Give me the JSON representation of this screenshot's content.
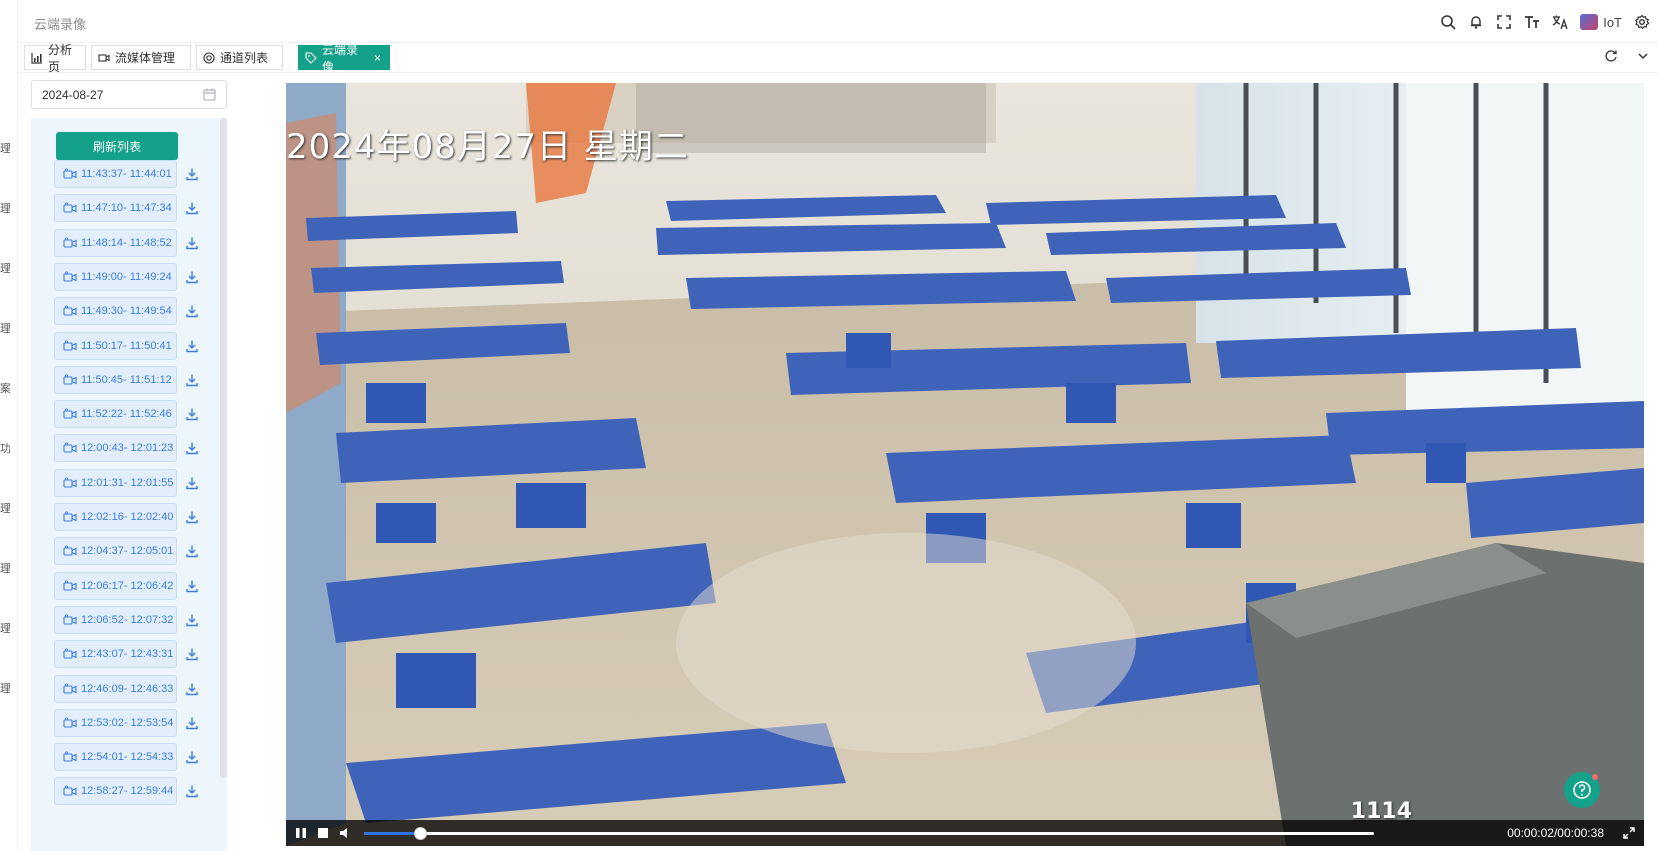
{
  "header": {
    "breadcrumb": "云端录像",
    "brand": "IoT",
    "icons": [
      "search-icon",
      "bell-icon",
      "fullscreen-icon",
      "font-size-icon",
      "translate-icon",
      "settings-icon"
    ]
  },
  "tabs": [
    {
      "label": "分析页",
      "icon": "chart-icon",
      "active": false
    },
    {
      "label": "流媒体管理",
      "icon": "video-icon",
      "active": false
    },
    {
      "label": "通道列表",
      "icon": "target-icon",
      "active": false
    },
    {
      "label": "云端录像",
      "icon": "tag-icon",
      "active": true
    }
  ],
  "sidebar_glyphs": [
    "理",
    "理",
    "理",
    "理",
    "案",
    "功",
    "理",
    "理",
    "理",
    "理"
  ],
  "date_picker": {
    "value": "2024-08-27"
  },
  "list": {
    "refresh_label": "刷新列表",
    "records": [
      "11:43:37- 11:44:01",
      "11:47:10- 11:47:34",
      "11:48:14- 11:48:52",
      "11:49:00- 11:49:24",
      "11:49:30- 11:49:54",
      "11:50:17- 11:50:41",
      "11:50:45- 11:51:12",
      "11:52:22- 11:52:46",
      "12:00:43- 12:01:23",
      "12:01:31- 12:01:55",
      "12:02:16- 12:02:40",
      "12:04:37- 12:05:01",
      "12:06:17- 12:06:42",
      "12:06:52- 12:07:32",
      "12:43:07- 12:43:31",
      "12:46:09- 12:46:33",
      "12:53:02- 12:53:54",
      "12:54:01- 12:54:33",
      "12:58:27- 12:59:44"
    ]
  },
  "player": {
    "osd_date": "2024年08月27日 星期二",
    "osd_id": "1114",
    "timecode": "00:00:02/00:00:38",
    "progress": 0.055
  },
  "colors": {
    "accent": "#13a18a",
    "list_bg": "#eef6fd",
    "record_text": "#3b7de0"
  }
}
